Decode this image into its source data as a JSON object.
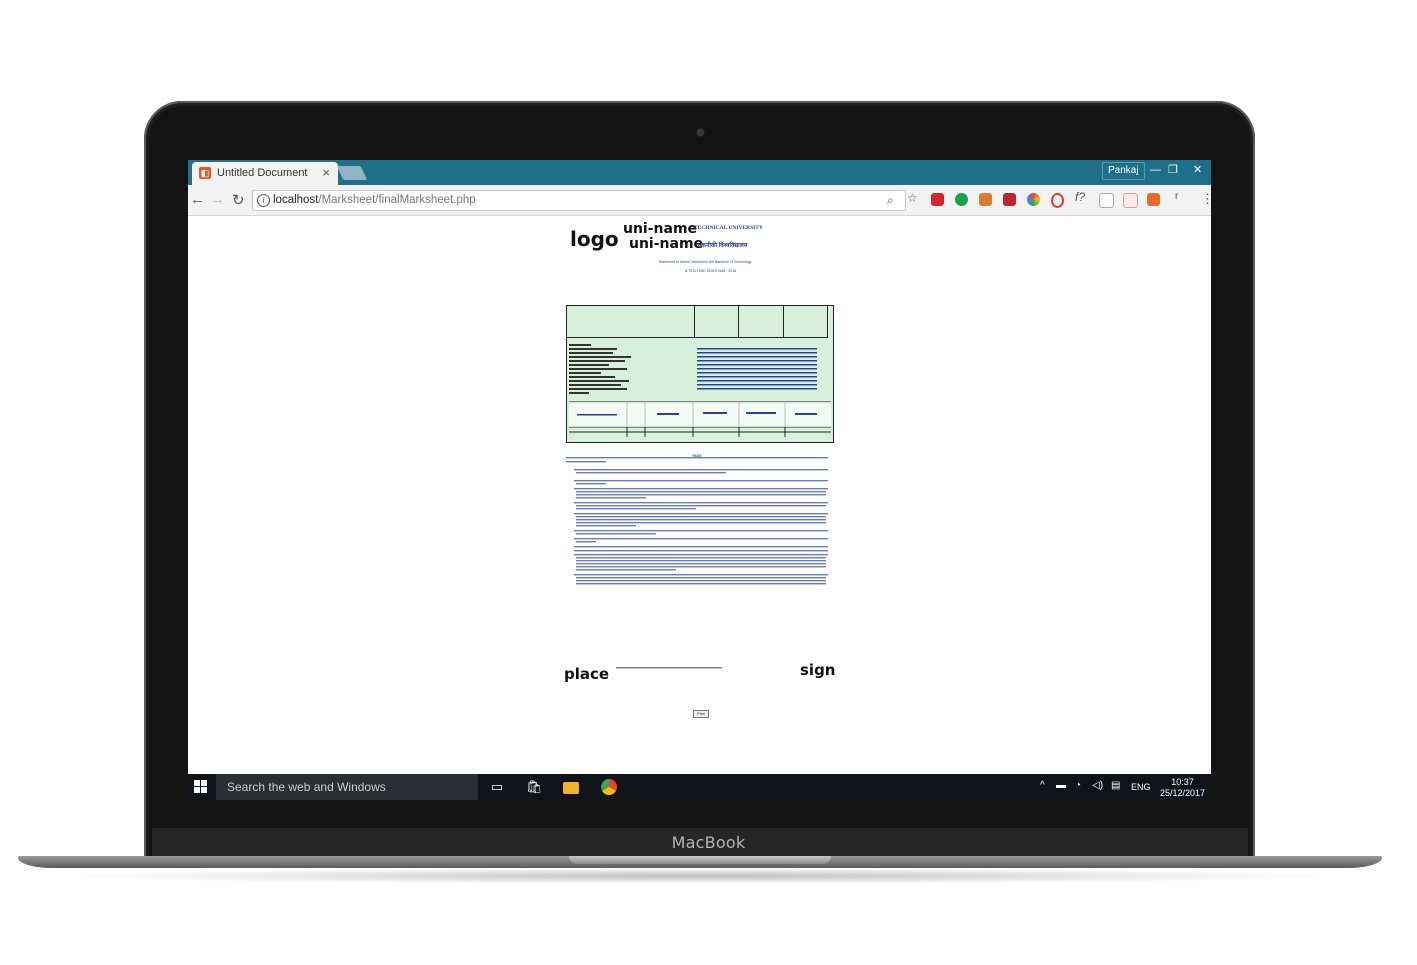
{
  "device": {
    "brand": "MacBook"
  },
  "browser": {
    "tab_title": "Untitled Document",
    "tab_close": "×",
    "user": "Pankaj",
    "url_host": "localhost",
    "url_path": "/Marksheet/finalMarksheet.php"
  },
  "document": {
    "logo": "logo",
    "uni_name_1": "uni-name",
    "uni_name_2": "uni-name",
    "university": "TECHNICAL UNIVERSITY",
    "university_hindi": "तकनीकी विश्वविद्यालय",
    "statement": "Statement of Marks Obtained in the Bachelor of Technology",
    "exam": "B.TECH 3RD SEM EXAM - 2016",
    "place": "place",
    "sign": "sign",
    "print_label": "Print",
    "pass_label": "PASS"
  },
  "taskbar": {
    "search_placeholder": "Search the web and Windows",
    "language": "ENG",
    "time": "10:37",
    "date": "25/12/2017"
  }
}
